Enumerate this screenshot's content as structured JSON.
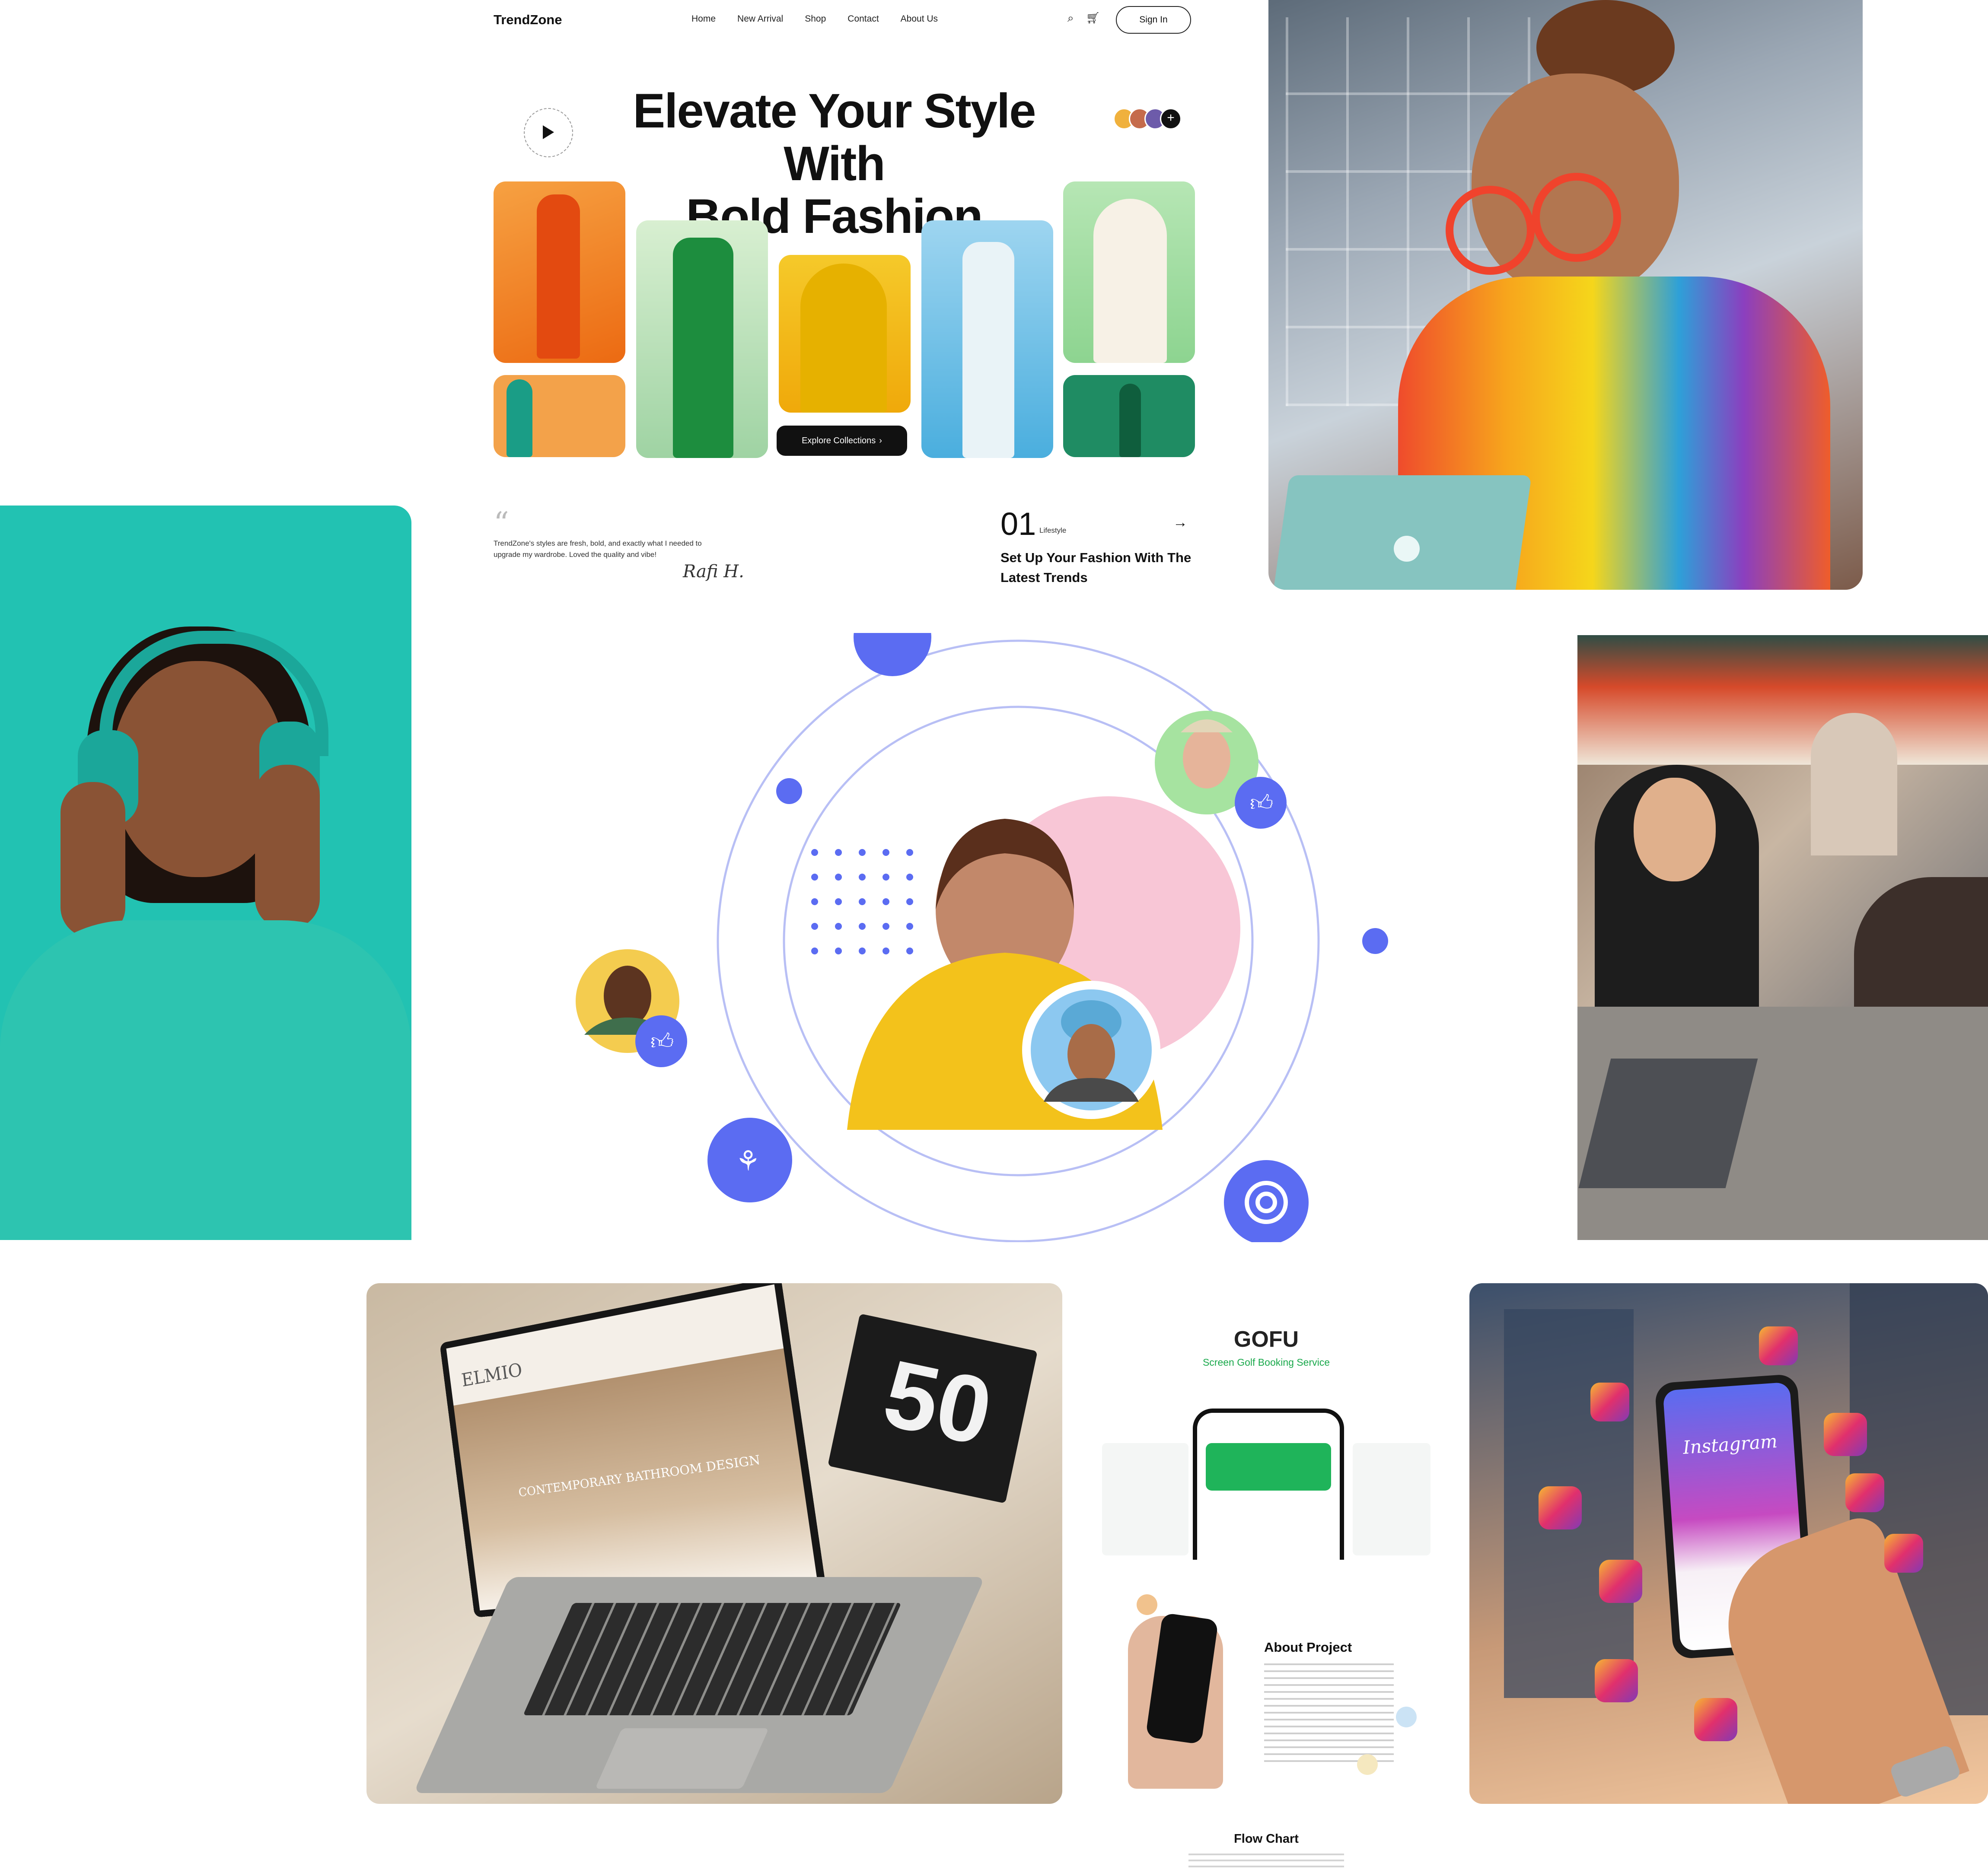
{
  "trendzone": {
    "logo": "TrendZone",
    "nav": [
      "Home",
      "New Arrival",
      "Shop",
      "Contact",
      "About Us"
    ],
    "sign_in": "Sign In",
    "hero_line1": "Elevate Your Style With",
    "hero_line2": "Bold Fashion",
    "explore_button": "Explore Collections",
    "testimonial": "TrendZone's styles are fresh, bold, and exactly what I needed to upgrade my wardrobe. Loved the quality and vibe!",
    "signature": "Rafi H.",
    "feature_number": "01",
    "feature_tag": "Lifestyle",
    "feature_title": "Set Up Your Fashion With The Latest Trends",
    "colors": {
      "orange": "#f07a1c",
      "green": "#2e9a55",
      "yellow": "#f5b800",
      "blue": "#59b7e3",
      "mint": "#a6dfa8",
      "teal": "#1e8a5f"
    }
  },
  "gofu": {
    "title": "GOFU",
    "subtitle": "Screen Golf Booking Service",
    "about_heading": "About Project",
    "flow_heading": "Flow Chart"
  },
  "insta": {
    "app_name": "Instagram"
  },
  "laptop": {
    "brand": "ELMIO",
    "banner": "CONTEMPORARY BATHROOM DESIGN",
    "book": "50"
  },
  "orbit": {
    "accent": "#5b6cf2",
    "pink": "#f9c9d8"
  }
}
